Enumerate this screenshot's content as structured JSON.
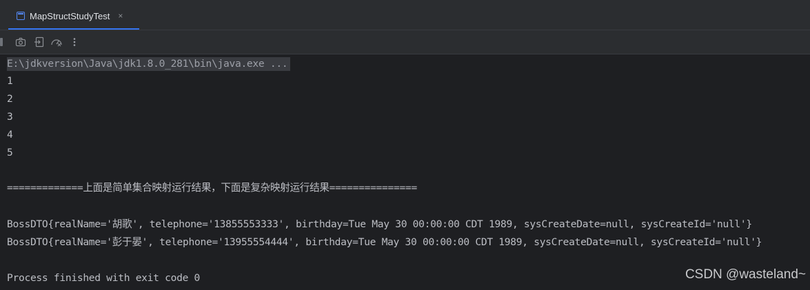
{
  "tab": {
    "title": "MapStructStudyTest",
    "icon": "console-window-icon",
    "close_glyph": "×"
  },
  "toolbar": {
    "buttons": [
      "camera-icon",
      "exit-icon",
      "gauge-icon",
      "more-vertical-icon"
    ]
  },
  "console": {
    "command": "E:\\jdkversion\\Java\\jdk1.8.0_281\\bin\\java.exe ...",
    "lines": [
      "1",
      "2",
      "3",
      "4",
      "5",
      "",
      "=============上面是简单集合映射运行结果，下面是复杂映射运行结果===============",
      "",
      "BossDTO{realName='胡歌', telephone='13855553333', birthday=Tue May 30 00:00:00 CDT 1989, sysCreateDate=null, sysCreateId='null'}",
      "BossDTO{realName='彭于晏', telephone='13955554444', birthday=Tue May 30 00:00:00 CDT 1989, sysCreateDate=null, sysCreateId='null'}",
      "",
      "Process finished with exit code 0"
    ]
  },
  "watermark": "CSDN @wasteland~",
  "colors": {
    "background": "#1e1f22",
    "panel": "#2b2d30",
    "text": "#bcbec4",
    "accent": "#3574f0"
  }
}
